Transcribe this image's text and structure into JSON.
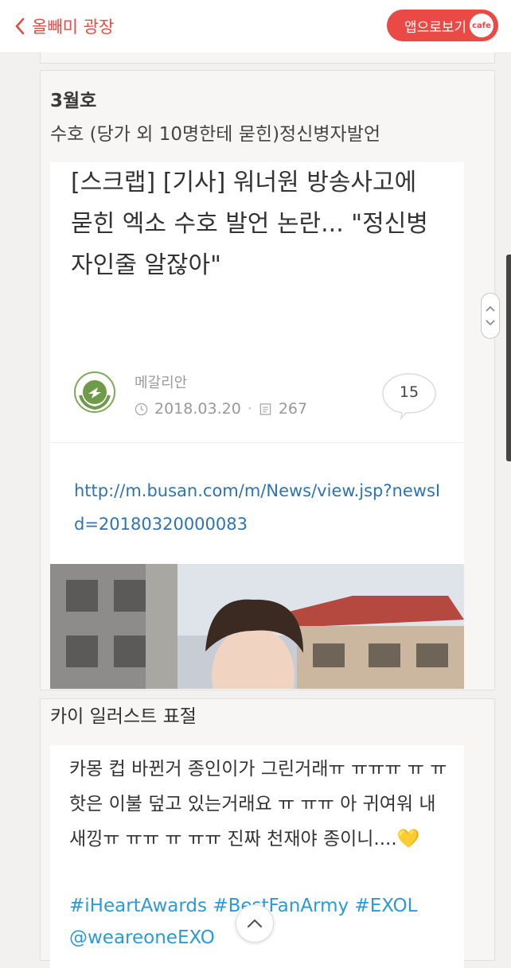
{
  "topbar": {
    "back_label": "올빼미 광장",
    "app_button_label": "앱으로보기",
    "app_badge": "cafe",
    "accent": "#ea4a45"
  },
  "post": {
    "issue": "3월호",
    "subtitle": "수호 (당가 외 10명한테 묻힌)정신병자발언",
    "card": {
      "title": "[스크랩] [기사] 워너원 방송사고에 묻힌 엑소 수호 발언 논란... \"정신병자인줄 알잖아\"",
      "author": "메갈리안",
      "date": "2018.03.20",
      "views": "267",
      "comments": "15",
      "link": "http://m.busan.com/m/News/view.jsp?newsId=20180320000083"
    }
  },
  "post2": {
    "title": "카이 일러스트 표절",
    "tweet_text": "카몽 컵 바뀐거 종인이가 그린거래ㅠ ㅠㅠㅠ ㅠ ㅠ 핫은 이불 덮고 있는거래요 ㅠ ㅠㅠ 아 귀여워 내새낑ㅠ ㅠㅠ ㅠ ㅠㅠ 진짜 천재야 종이니....",
    "tweet_emoji": "💛",
    "tweet_tags": "#iHeartAwards #BestFanArmy #EXOL @weareoneEXO",
    "link_color": "#2b9ad6"
  },
  "icons": {
    "back": "chevron-left-icon",
    "clock": "clock-icon",
    "views": "document-icon",
    "comment": "speech-bubble-icon",
    "scroll_up": "chevron-up-icon"
  }
}
